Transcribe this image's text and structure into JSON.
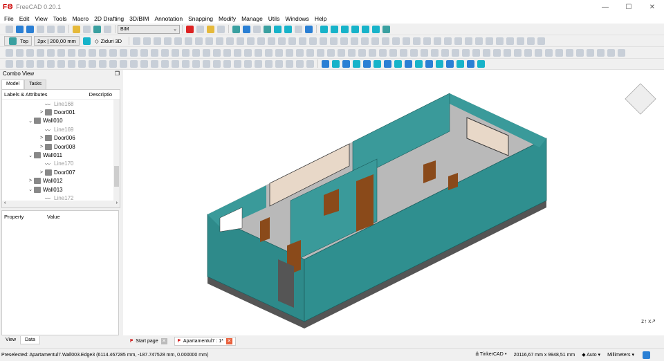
{
  "app": {
    "title": "FreeCAD 0.20.1"
  },
  "menu": [
    "File",
    "Edit",
    "View",
    "Tools",
    "Macro",
    "2D Drafting",
    "3D/BIM",
    "Annotation",
    "Snapping",
    "Modify",
    "Manage",
    "Utils",
    "Windows",
    "Help"
  ],
  "toolbar": {
    "workbench": "BIM",
    "view_label": "Top",
    "line_style": "2px | 200,00 mm",
    "working_plane": "Ziduri 3D"
  },
  "combo_view": {
    "title": "Combo View",
    "tabs": [
      "Model",
      "Tasks"
    ],
    "tree_header": [
      "Labels & Attributes",
      "Descriptio"
    ],
    "tree": [
      {
        "label": "Line168",
        "depth": 2,
        "type": "line",
        "expander": ""
      },
      {
        "label": "Door001",
        "depth": 2,
        "type": "door",
        "expander": ">"
      },
      {
        "label": "Wall010",
        "depth": 1,
        "type": "wall",
        "expander": "v"
      },
      {
        "label": "Line169",
        "depth": 2,
        "type": "line",
        "expander": ""
      },
      {
        "label": "Door006",
        "depth": 2,
        "type": "door",
        "expander": ">"
      },
      {
        "label": "Door008",
        "depth": 2,
        "type": "door",
        "expander": ">"
      },
      {
        "label": "Wall011",
        "depth": 1,
        "type": "wall",
        "expander": "v"
      },
      {
        "label": "Line170",
        "depth": 2,
        "type": "line",
        "expander": ""
      },
      {
        "label": "Door007",
        "depth": 2,
        "type": "door",
        "expander": ">"
      },
      {
        "label": "Wall012",
        "depth": 1,
        "type": "wall",
        "expander": ">"
      },
      {
        "label": "Wall013",
        "depth": 1,
        "type": "wall",
        "expander": "v"
      },
      {
        "label": "Line172",
        "depth": 2,
        "type": "line",
        "expander": ""
      }
    ],
    "property_header": [
      "Property",
      "Value"
    ],
    "bottom_tabs": [
      "View",
      "Data"
    ]
  },
  "doc_tabs": [
    {
      "label": "Start page",
      "active": false
    },
    {
      "label": "Apartamentul7 : 1*",
      "active": true
    }
  ],
  "status": {
    "preselected": "Preselected: Apartamentul7.Wall003.Edge3 (6114.467285 mm, -187.747528 mm, 0.000000 mm)",
    "nav_style": "TinkerCAD",
    "dimensions": "20116,67 mm x 9948,51 mm",
    "render": "Auto",
    "units": "Millimeters"
  },
  "colors": {
    "wall": "#2e8a8a",
    "door": "#8a4a1a",
    "window": "#e8d8c8",
    "floor": "#555555"
  }
}
